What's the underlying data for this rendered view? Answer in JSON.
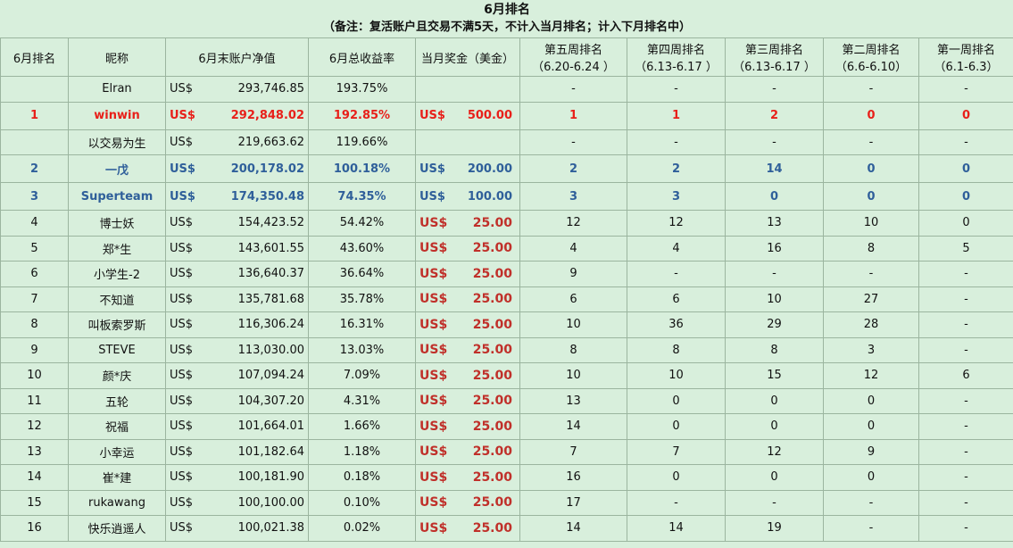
{
  "title": "6月排名",
  "note": "（备注：复活账户且交易不满5天，不计入当月排名；计入下月排名中）",
  "headers": {
    "rank": "6月排名",
    "nickname": "昵称",
    "equity": "6月末账户净值",
    "return": "6月总收益率",
    "prize": "当月奖金（美金）",
    "w5": [
      "第五周排名",
      "（6.20-6.24 ）"
    ],
    "w4": [
      "第四周排名",
      "（6.13-6.17 ）"
    ],
    "w3": [
      "第三周排名",
      "（6.13-6.17 ）"
    ],
    "w2": [
      "第二周排名",
      "（6.6-6.10）"
    ],
    "w1": [
      "第一周排名",
      "（6.1-6.3）"
    ]
  },
  "rows": [
    {
      "rank": "",
      "name": "Elran",
      "cur": "US$",
      "equity": "293,746.85",
      "return": "193.75%",
      "pcur": "",
      "prize": "",
      "w5": "-",
      "w4": "-",
      "w3": "-",
      "w2": "-",
      "w1": "-"
    },
    {
      "rank": "1",
      "name": "winwin",
      "cur": "US$",
      "equity": "292,848.02",
      "return": "192.85%",
      "pcur": "US$",
      "prize": "500.00",
      "w5": "1",
      "w4": "1",
      "w3": "2",
      "w2": "0",
      "w1": "0"
    },
    {
      "rank": "",
      "name": "以交易为生",
      "cur": "US$",
      "equity": "219,663.62",
      "return": "119.66%",
      "pcur": "",
      "prize": "",
      "w5": "-",
      "w4": "-",
      "w3": "-",
      "w2": "-",
      "w1": "-"
    },
    {
      "rank": "2",
      "name": "一戊",
      "cur": "US$",
      "equity": "200,178.02",
      "return": "100.18%",
      "pcur": "US$",
      "prize": "200.00",
      "w5": "2",
      "w4": "2",
      "w3": "14",
      "w2": "0",
      "w1": "0"
    },
    {
      "rank": "3",
      "name": "Superteam",
      "cur": "US$",
      "equity": "174,350.48",
      "return": "74.35%",
      "pcur": "US$",
      "prize": "100.00",
      "w5": "3",
      "w4": "3",
      "w3": "0",
      "w2": "0",
      "w1": "0"
    },
    {
      "rank": "4",
      "name": "博士妖",
      "cur": "US$",
      "equity": "154,423.52",
      "return": "54.42%",
      "pcur": "US$",
      "prize": "25.00",
      "w5": "12",
      "w4": "12",
      "w3": "13",
      "w2": "10",
      "w1": "0"
    },
    {
      "rank": "5",
      "name": "郑*生",
      "cur": "US$",
      "equity": "143,601.55",
      "return": "43.60%",
      "pcur": "US$",
      "prize": "25.00",
      "w5": "4",
      "w4": "4",
      "w3": "16",
      "w2": "8",
      "w1": "5"
    },
    {
      "rank": "6",
      "name": "小学生-2",
      "cur": "US$",
      "equity": "136,640.37",
      "return": "36.64%",
      "pcur": "US$",
      "prize": "25.00",
      "w5": "9",
      "w4": "-",
      "w3": "-",
      "w2": "-",
      "w1": "-"
    },
    {
      "rank": "7",
      "name": "不知道",
      "cur": "US$",
      "equity": "135,781.68",
      "return": "35.78%",
      "pcur": "US$",
      "prize": "25.00",
      "w5": "6",
      "w4": "6",
      "w3": "10",
      "w2": "27",
      "w1": "-"
    },
    {
      "rank": "8",
      "name": "叫板索罗斯",
      "cur": "US$",
      "equity": "116,306.24",
      "return": "16.31%",
      "pcur": "US$",
      "prize": "25.00",
      "w5": "10",
      "w4": "36",
      "w3": "29",
      "w2": "28",
      "w1": "-"
    },
    {
      "rank": "9",
      "name": "STEVE",
      "cur": "US$",
      "equity": "113,030.00",
      "return": "13.03%",
      "pcur": "US$",
      "prize": "25.00",
      "w5": "8",
      "w4": "8",
      "w3": "8",
      "w2": "3",
      "w1": "-"
    },
    {
      "rank": "10",
      "name": "颜*庆",
      "cur": "US$",
      "equity": "107,094.24",
      "return": "7.09%",
      "pcur": "US$",
      "prize": "25.00",
      "w5": "10",
      "w4": "10",
      "w3": "15",
      "w2": "12",
      "w1": "6"
    },
    {
      "rank": "11",
      "name": "五轮",
      "cur": "US$",
      "equity": "104,307.20",
      "return": "4.31%",
      "pcur": "US$",
      "prize": "25.00",
      "w5": "13",
      "w4": "0",
      "w3": "0",
      "w2": "0",
      "w1": "-"
    },
    {
      "rank": "12",
      "name": "祝福",
      "cur": "US$",
      "equity": "101,664.01",
      "return": "1.66%",
      "pcur": "US$",
      "prize": "25.00",
      "w5": "14",
      "w4": "0",
      "w3": "0",
      "w2": "0",
      "w1": "-"
    },
    {
      "rank": "13",
      "name": "小幸运",
      "cur": "US$",
      "equity": "101,182.64",
      "return": "1.18%",
      "pcur": "US$",
      "prize": "25.00",
      "w5": "7",
      "w4": "7",
      "w3": "12",
      "w2": "9",
      "w1": "-"
    },
    {
      "rank": "14",
      "name": "崔*建",
      "cur": "US$",
      "equity": "100,181.90",
      "return": "0.18%",
      "pcur": "US$",
      "prize": "25.00",
      "w5": "16",
      "w4": "0",
      "w3": "0",
      "w2": "0",
      "w1": "-"
    },
    {
      "rank": "15",
      "name": "rukawang",
      "cur": "US$",
      "equity": "100,100.00",
      "return": "0.10%",
      "pcur": "US$",
      "prize": "25.00",
      "w5": "17",
      "w4": "-",
      "w3": "-",
      "w2": "-",
      "w1": "-"
    },
    {
      "rank": "16",
      "name": "快乐逍遥人",
      "cur": "US$",
      "equity": "100,021.38",
      "return": "0.02%",
      "pcur": "US$",
      "prize": "25.00",
      "w5": "14",
      "w4": "14",
      "w3": "19",
      "w2": "-",
      "w1": "-"
    }
  ],
  "styles": {
    "red_rows": [
      1
    ],
    "blue_rows": [
      3,
      4
    ],
    "tall_rows": [
      1,
      3,
      4
    ]
  }
}
